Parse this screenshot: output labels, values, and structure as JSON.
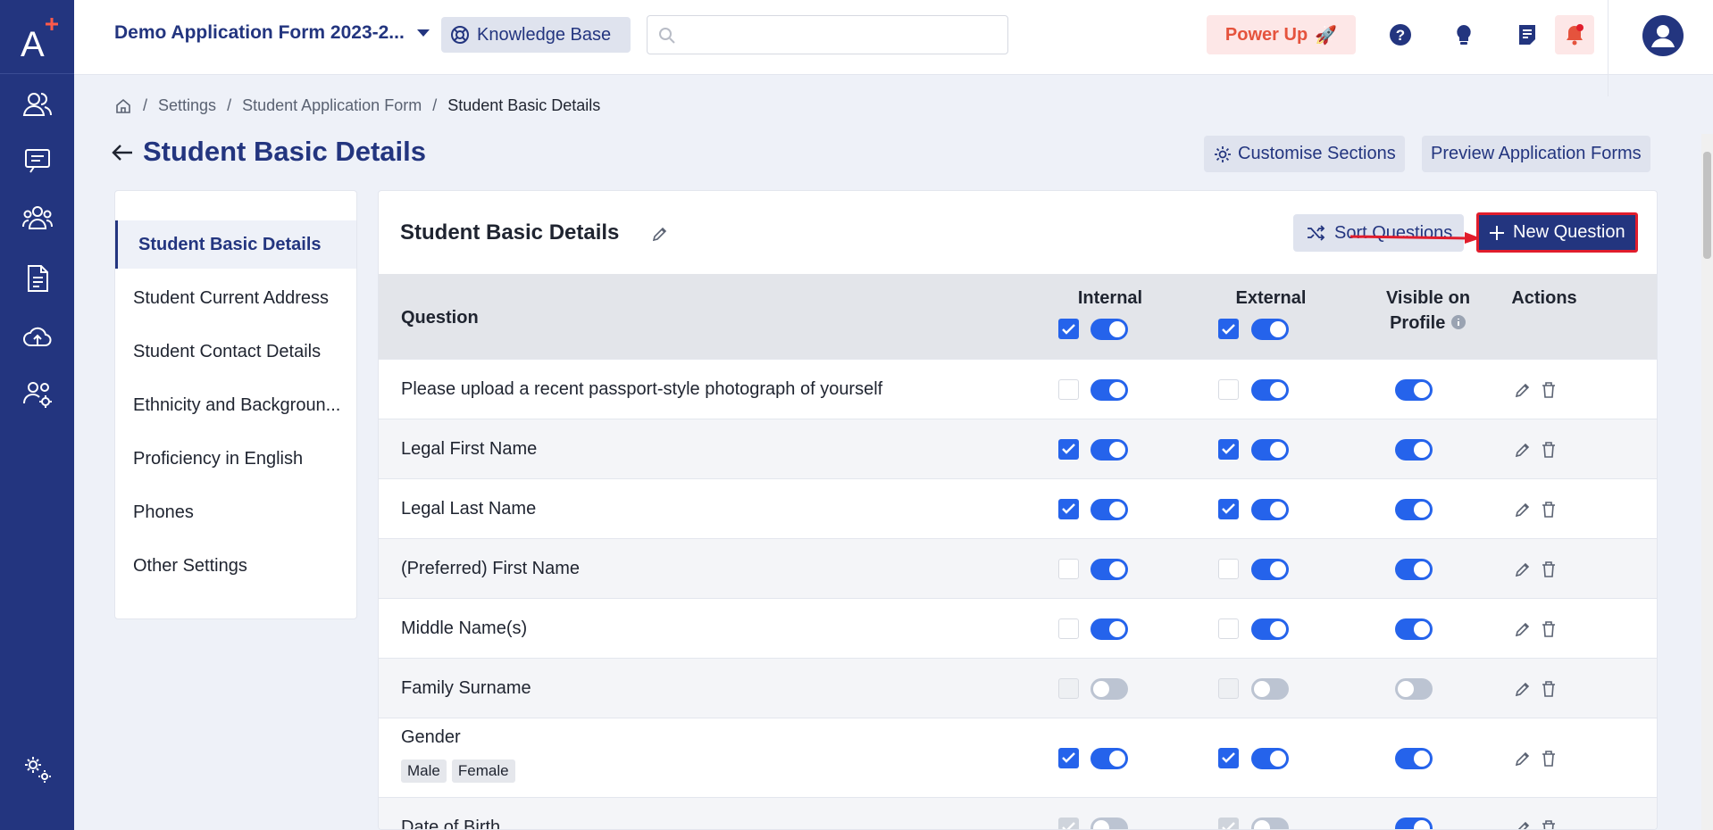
{
  "topbar": {
    "app_title": "Demo Application Form 2023-2...",
    "knowledge_base": "Knowledge Base",
    "search_placeholder": "",
    "power_up": "Power Up"
  },
  "breadcrumb": [
    "Settings",
    "Student Application Form",
    "Student Basic Details"
  ],
  "page_title": "Student Basic Details",
  "header_buttons": {
    "customise": "Customise Sections",
    "preview": "Preview Application Forms"
  },
  "left_nav": [
    "Student Basic Details",
    "Student Current Address",
    "Student Contact Details",
    "Ethnicity and Backgroun...",
    "Proficiency in English",
    "Phones",
    "Other Settings"
  ],
  "panel": {
    "title": "Student Basic Details",
    "sort_button": "Sort Questions",
    "new_button": "New Question"
  },
  "table": {
    "headers": {
      "question": "Question",
      "internal": "Internal",
      "external": "External",
      "visible_line1": "Visible on",
      "visible_line2": "Profile",
      "actions": "Actions"
    },
    "rows": [
      {
        "question": "Please upload a recent passport-style photograph of yourself"
      },
      {
        "question": "Legal First Name"
      },
      {
        "question": "Legal Last Name"
      },
      {
        "question": "(Preferred) First Name"
      },
      {
        "question": "Middle Name(s)"
      },
      {
        "question": "Family Surname"
      },
      {
        "question": "Gender",
        "tags": [
          "Male",
          "Female"
        ]
      },
      {
        "question": "Date of Birth"
      }
    ]
  },
  "colors": {
    "brand": "#23357f",
    "accent": "#2563eb",
    "highlight": "#e11d2c"
  }
}
